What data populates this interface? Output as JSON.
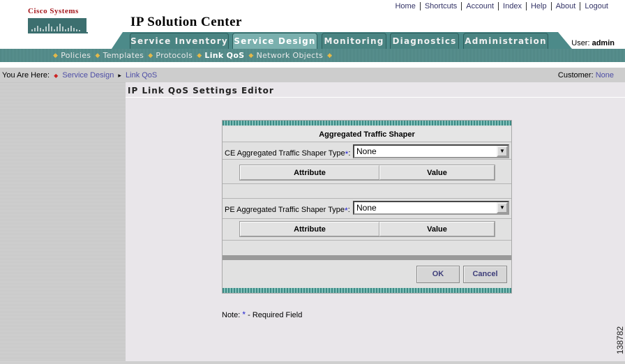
{
  "brand": {
    "logo_text": "Cisco Systems"
  },
  "app_title": "IP Solution Center",
  "top_links": [
    "Home",
    "Shortcuts",
    "Account",
    "Index",
    "Help",
    "About",
    "Logout"
  ],
  "tabs": [
    {
      "label": "Service Inventory",
      "active": false
    },
    {
      "label": "Service Design",
      "active": true
    },
    {
      "label": "Monitoring",
      "active": false
    },
    {
      "label": "Diagnostics",
      "active": false
    },
    {
      "label": "Administration",
      "active": false
    }
  ],
  "user": {
    "label": "User:",
    "name": "admin"
  },
  "subnav": [
    {
      "label": "Policies",
      "active": false
    },
    {
      "label": "Templates",
      "active": false
    },
    {
      "label": "Protocols",
      "active": false
    },
    {
      "label": "Link QoS",
      "active": true
    },
    {
      "label": "Network Objects",
      "active": false
    }
  ],
  "breadcrumb": {
    "prefix": "You Are Here:",
    "items": [
      "Service Design",
      "Link QoS"
    ]
  },
  "customer": {
    "label": "Customer:",
    "value": "None"
  },
  "page_title": "IP Link QoS Settings Editor",
  "form": {
    "header": "Aggregated Traffic Shaper",
    "ce": {
      "label": "CE Aggregated Traffic Shaper Type",
      "required_mark": "*",
      "value": "None"
    },
    "pe": {
      "label": "PE Aggregated Traffic Shaper Type",
      "required_mark": "*",
      "value": "None"
    },
    "table_headers": {
      "attribute": "Attribute",
      "value": "Value"
    },
    "buttons": {
      "ok": "OK",
      "cancel": "Cancel"
    }
  },
  "note": {
    "prefix": "Note:",
    "mark": "*",
    "text": "- Required Field"
  },
  "figure_number": "138782",
  "colors": {
    "tab_bar": "#4a8482",
    "subnav": "#5e9795",
    "link": "#4e4ea6",
    "brand_red": "#a4151a",
    "required": "#1f1fd0"
  }
}
